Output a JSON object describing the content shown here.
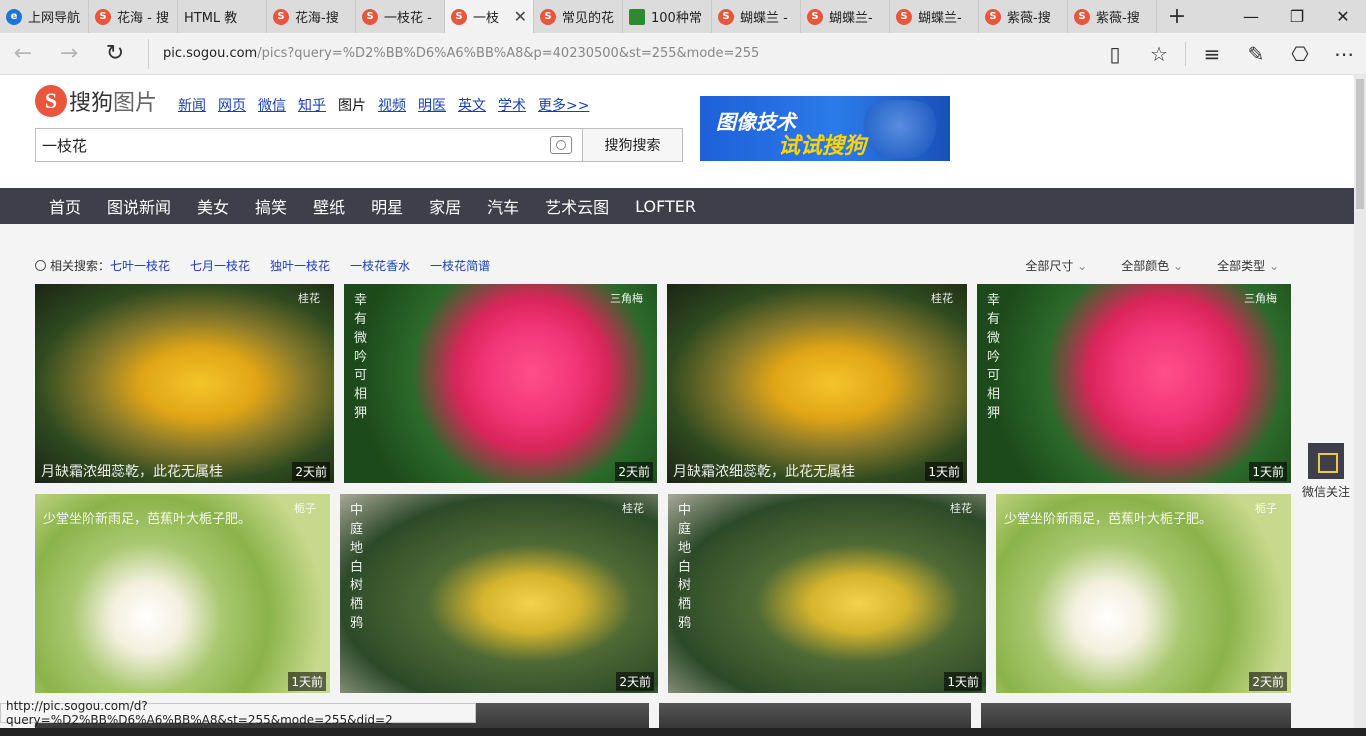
{
  "browser": {
    "tabs": [
      {
        "title": "上网导航",
        "icon": "ie"
      },
      {
        "title": "花海 - 搜",
        "icon": "sogou"
      },
      {
        "title": "HTML 教",
        "icon": "page"
      },
      {
        "title": "花海-搜",
        "icon": "sogou"
      },
      {
        "title": "一枝花 -",
        "icon": "sogou"
      },
      {
        "title": "一枝",
        "icon": "sogou",
        "active": true
      },
      {
        "title": "常见的花",
        "icon": "sogou"
      },
      {
        "title": "100种常",
        "icon": "green"
      },
      {
        "title": "蝴蝶兰 -",
        "icon": "sogou"
      },
      {
        "title": "蝴蝶兰-",
        "icon": "sogou"
      },
      {
        "title": "蝴蝶兰-",
        "icon": "sogou"
      },
      {
        "title": "紫薇-搜",
        "icon": "sogou"
      },
      {
        "title": "紫薇-搜",
        "icon": "sogou"
      }
    ],
    "new_tab": "+",
    "window_controls": {
      "minimize": "—",
      "maximize": "❐",
      "close": "✕"
    },
    "address": {
      "host": "pic.sogou.com",
      "path": "/pics?query=%D2%BB%D6%A6%BB%A8&p=40230500&st=255&mode=255"
    },
    "status_url": "http://pic.sogou.com/d?query=%D2%BB%D6%A6%BB%A8&st=255&mode=255&did=2"
  },
  "site": {
    "logo_letter": "S",
    "logo_text": "搜狗",
    "logo_sub": "图片",
    "channels": [
      "新闻",
      "网页",
      "微信",
      "知乎",
      "图片",
      "视频",
      "明医",
      "英文",
      "学术",
      "更多>>"
    ],
    "current_channel": "图片",
    "search_value": "一枝花",
    "search_button": "搜狗搜索",
    "ad_line1": "图像技术",
    "ad_line2": "试试搜狗",
    "categories": [
      "首页",
      "图说新闻",
      "美女",
      "搞笑",
      "壁纸",
      "明星",
      "家居",
      "汽车",
      "艺术云图",
      "LOFTER"
    ],
    "related_label": "相关搜索：",
    "related": [
      "七叶一枝花",
      "七月一枝花",
      "独叶一枝花",
      "一枝花香水",
      "一枝花简谱"
    ],
    "filters": [
      "全部尺寸",
      "全部颜色",
      "全部类型"
    ],
    "wechat_label": "微信关注"
  },
  "images": [
    {
      "style": "osm",
      "age": "2天前",
      "poem": "月缺霜浓细蕊乾，此花无属桂",
      "tag": "桂花"
    },
    {
      "style": "bougain",
      "age": "2天前",
      "poem": "幸有微吟可相狎",
      "tag": "三角梅"
    },
    {
      "style": "osm",
      "age": "1天前",
      "poem": "月缺霜浓细蕊乾，此花无属桂",
      "tag": "桂花"
    },
    {
      "style": "bougain",
      "age": "1天前",
      "poem": "幸有微吟可相狎",
      "tag": "三角梅"
    },
    {
      "style": "gardenia",
      "age": "1天前",
      "poem": "少堂坐阶新雨足，芭蕉叶大栀子肥。",
      "tag": "栀子"
    },
    {
      "style": "osm2",
      "age": "2天前",
      "poem": "中庭地白树栖鸦",
      "tag": "桂花"
    },
    {
      "style": "osm2",
      "age": "1天前",
      "poem": "中庭地白树栖鸦",
      "tag": "桂花"
    },
    {
      "style": "gardenia",
      "age": "2天前",
      "poem": "少堂坐阶新雨足，芭蕉叶大栀子肥。",
      "tag": "栀子"
    }
  ]
}
